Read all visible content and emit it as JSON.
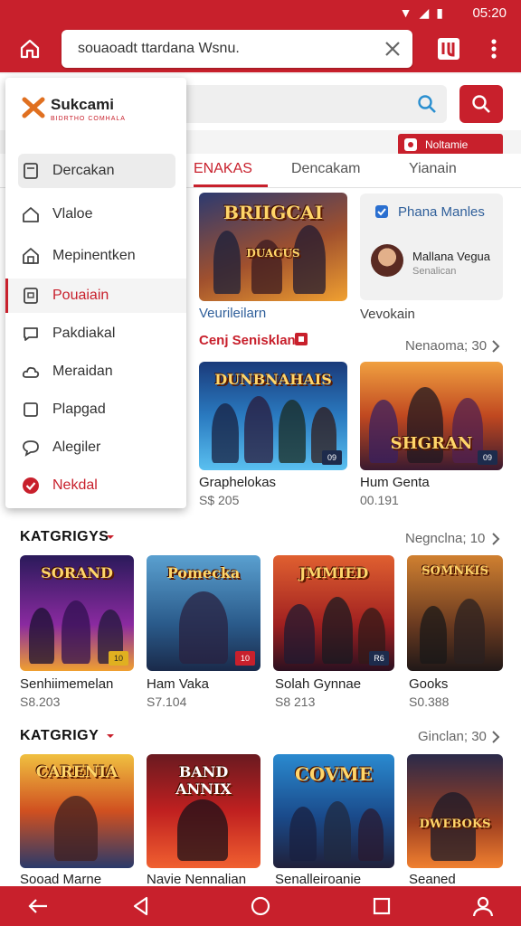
{
  "status": {
    "time": "05:20"
  },
  "toolbar": {
    "url_text": "souaoadt ttardana Wsnu."
  },
  "search": {
    "placeholder": ""
  },
  "promo_label": "Noltamie",
  "tabs": [
    {
      "label": "ENAKAS"
    },
    {
      "label": "Dencakam"
    },
    {
      "label": "Yianain"
    }
  ],
  "drawer": {
    "brand": "Sukcami",
    "tagline": "BIDRTHO COMHALA",
    "items": [
      {
        "label": "Dercakan"
      },
      {
        "label": "Vlaloe"
      },
      {
        "label": "Mepinentken"
      },
      {
        "label": "Pouaiain"
      },
      {
        "label": "Pakdiakal"
      },
      {
        "label": "Meraidan"
      },
      {
        "label": "Plapgad"
      },
      {
        "label": "Alegiler"
      },
      {
        "label": "Nekdal"
      }
    ]
  },
  "featured": {
    "banner_title": "BRIIGCAI",
    "banner_subtitle": "DUAGUS",
    "caption_left": "Veurileilarn",
    "caption_right": "Vevokain",
    "info_card": {
      "title": "Phana Manles",
      "user": "Mallana Vegua",
      "sub": "Senalican"
    }
  },
  "section1": {
    "title": "Cenj Senisklan",
    "more": "Nenaoma; 30",
    "items": [
      {
        "title": "Graphelokas",
        "price": "S$ 205",
        "art": "DUNBNAHAIS",
        "badge": "09"
      },
      {
        "title": "Hum Genta",
        "price": "00.191",
        "art": "SHGRAN",
        "badge": "09"
      }
    ]
  },
  "section2": {
    "title": "KATGRIGYS",
    "more": "Negnclna; 10",
    "items": [
      {
        "title": "Senhiimemelan",
        "price": "S8.203",
        "art": "SORAND",
        "badge": "10"
      },
      {
        "title": "Ham Vaka",
        "price": "S7.104",
        "art": "Pomecka",
        "badge": "10"
      },
      {
        "title": "Solah Gynnae",
        "price": "S8 213",
        "art": "JMMIED",
        "badge": "R6"
      },
      {
        "title": "Gooks",
        "price": "S0.388",
        "art": "SOMNKIS",
        "badge": ""
      }
    ]
  },
  "section3": {
    "title": "KATGRIGY",
    "more": "Ginclan; 30",
    "items": [
      {
        "title": "Sooad Marne",
        "art": "CARENIA"
      },
      {
        "title": "Navie Nennalian",
        "art": "BAND ANNIX"
      },
      {
        "title": "Senalleiroanie",
        "art": "COVME"
      },
      {
        "title": "Seaned",
        "art": "DWEBOKS"
      }
    ]
  },
  "colors": {
    "accent": "#c8202c"
  }
}
